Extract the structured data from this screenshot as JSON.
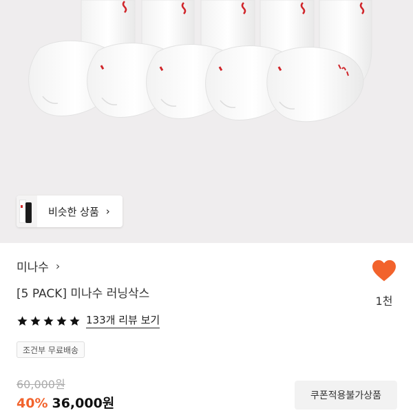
{
  "similar": {
    "label": "비슷한 상품",
    "chevron": "›"
  },
  "brand": {
    "name": "미나수",
    "chevron": "›"
  },
  "product": {
    "title": "[5 PACK] 미나수 러닝삭스"
  },
  "rating": {
    "stars": 5,
    "review_link": "133개 리뷰 보기"
  },
  "shipping": {
    "badge": "조건부 무료배송"
  },
  "price": {
    "original": "60,000원",
    "discount": "40%",
    "sale": "36,000원"
  },
  "wish": {
    "count": "1천",
    "icon": "heart-icon",
    "color": "#f2632c"
  },
  "coupon": {
    "label": "쿠폰적용불가상품"
  },
  "colors": {
    "accent": "#f2632c",
    "sock_logo": "#d0252a",
    "hero_bg": "#efedee"
  }
}
